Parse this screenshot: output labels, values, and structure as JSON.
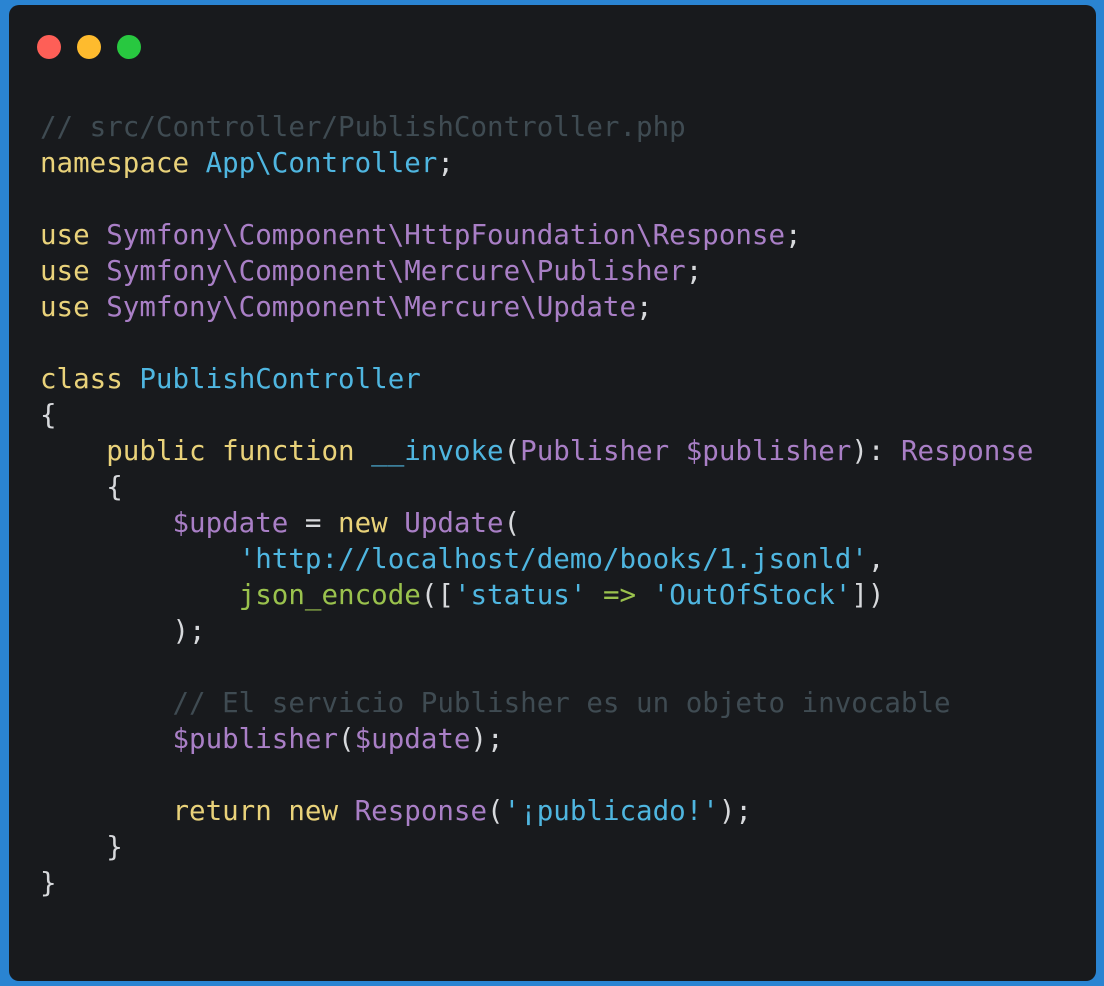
{
  "window": {
    "traffic_lights": [
      {
        "name": "close",
        "color": "#fe5f57"
      },
      {
        "name": "minimize",
        "color": "#febb2e"
      },
      {
        "name": "zoom",
        "color": "#28c840"
      }
    ]
  },
  "theme": {
    "background": "#181a1d",
    "comment": "#3f4b52",
    "keyword": "#e9d27a",
    "namespace": "#4fb6e0",
    "type": "#a97fc6",
    "function": "#9ac24d",
    "string": "#4fb6e0",
    "plain": "#d7d9dc"
  },
  "code": {
    "lines": [
      [
        {
          "t": "// src/Controller/PublishController.php",
          "c": "comment"
        }
      ],
      [
        {
          "t": "namespace",
          "c": "keyword"
        },
        {
          "t": " "
        },
        {
          "t": "App\\Controller",
          "c": "namespace"
        },
        {
          "t": ";"
        }
      ],
      [],
      [
        {
          "t": "use",
          "c": "keyword"
        },
        {
          "t": " "
        },
        {
          "t": "Symfony\\Component\\HttpFoundation\\Response",
          "c": "type"
        },
        {
          "t": ";"
        }
      ],
      [
        {
          "t": "use",
          "c": "keyword"
        },
        {
          "t": " "
        },
        {
          "t": "Symfony\\Component\\Mercure\\Publisher",
          "c": "type"
        },
        {
          "t": ";"
        }
      ],
      [
        {
          "t": "use",
          "c": "keyword"
        },
        {
          "t": " "
        },
        {
          "t": "Symfony\\Component\\Mercure\\Update",
          "c": "type"
        },
        {
          "t": ";"
        }
      ],
      [],
      [
        {
          "t": "class",
          "c": "keyword"
        },
        {
          "t": " "
        },
        {
          "t": "PublishController",
          "c": "namespace"
        }
      ],
      [
        {
          "t": "{"
        }
      ],
      [
        {
          "t": "    "
        },
        {
          "t": "public",
          "c": "keyword"
        },
        {
          "t": " "
        },
        {
          "t": "function",
          "c": "keyword"
        },
        {
          "t": " "
        },
        {
          "t": "__invoke",
          "c": "namespace"
        },
        {
          "t": "("
        },
        {
          "t": "Publisher",
          "c": "type"
        },
        {
          "t": " "
        },
        {
          "t": "$publisher",
          "c": "type"
        },
        {
          "t": "): "
        },
        {
          "t": "Response",
          "c": "type"
        }
      ],
      [
        {
          "t": "    {"
        }
      ],
      [
        {
          "t": "        "
        },
        {
          "t": "$update",
          "c": "type"
        },
        {
          "t": " = "
        },
        {
          "t": "new",
          "c": "keyword"
        },
        {
          "t": " "
        },
        {
          "t": "Update",
          "c": "type"
        },
        {
          "t": "("
        }
      ],
      [
        {
          "t": "            "
        },
        {
          "t": "'http://localhost/demo/books/1.jsonld'",
          "c": "string"
        },
        {
          "t": ","
        }
      ],
      [
        {
          "t": "            "
        },
        {
          "t": "json_encode",
          "c": "function"
        },
        {
          "t": "(["
        },
        {
          "t": "'status'",
          "c": "string"
        },
        {
          "t": " "
        },
        {
          "t": "=>",
          "c": "function"
        },
        {
          "t": " "
        },
        {
          "t": "'OutOfStock'",
          "c": "string"
        },
        {
          "t": "])"
        }
      ],
      [
        {
          "t": "        );"
        }
      ],
      [],
      [
        {
          "t": "        "
        },
        {
          "t": "// El servicio Publisher es un objeto invocable",
          "c": "comment"
        }
      ],
      [
        {
          "t": "        "
        },
        {
          "t": "$publisher",
          "c": "type"
        },
        {
          "t": "("
        },
        {
          "t": "$update",
          "c": "type"
        },
        {
          "t": ");"
        }
      ],
      [],
      [
        {
          "t": "        "
        },
        {
          "t": "return",
          "c": "keyword"
        },
        {
          "t": " "
        },
        {
          "t": "new",
          "c": "keyword"
        },
        {
          "t": " "
        },
        {
          "t": "Response",
          "c": "type"
        },
        {
          "t": "("
        },
        {
          "t": "'¡publicado!'",
          "c": "string"
        },
        {
          "t": ");"
        }
      ],
      [
        {
          "t": "    }"
        }
      ],
      [
        {
          "t": "}"
        }
      ]
    ]
  }
}
